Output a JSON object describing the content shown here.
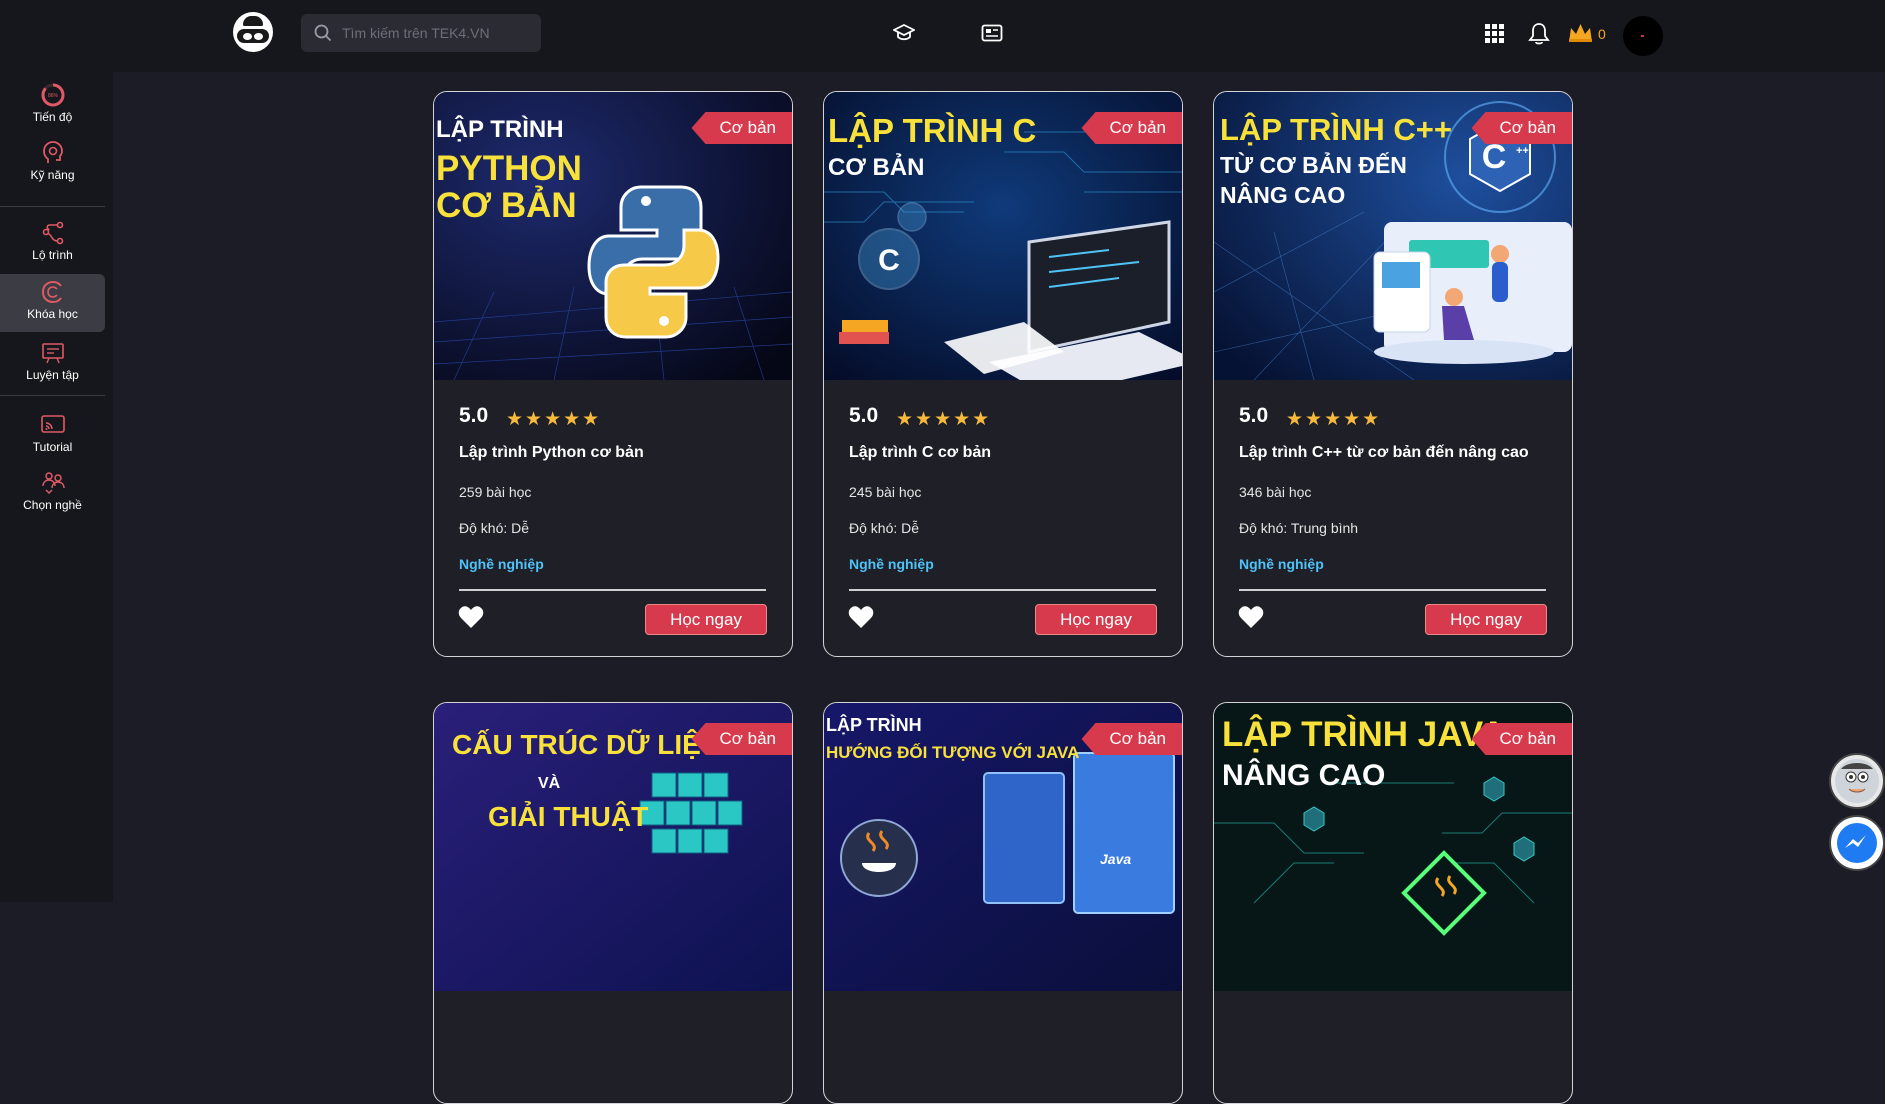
{
  "header": {
    "search_placeholder": "Tìm kiếm trên TEK4.VN",
    "crown_count": "0"
  },
  "sidebar": {
    "items": [
      {
        "label": "Tiến độ",
        "badge": "86%"
      },
      {
        "label": "Kỹ năng"
      },
      {
        "label": "Lộ trình"
      },
      {
        "label": "Khóa học"
      },
      {
        "label": "Luyện tập"
      },
      {
        "label": "Tutorial"
      },
      {
        "label": "Chọn nghề"
      }
    ]
  },
  "courses": [
    {
      "badge": "Cơ bản",
      "thumb_lines": [
        "LẬP TRÌNH",
        "PYTHON",
        "CƠ BẢN"
      ],
      "rating": "5.0",
      "stars": "★★★★★",
      "title": "Lập trình Python cơ bản",
      "lessons": "259 bài học",
      "difficulty": "Độ khó: Dễ",
      "career": "Nghề nghiệp",
      "button": "Học ngay"
    },
    {
      "badge": "Cơ bản",
      "thumb_lines": [
        "LẬP TRÌNH C",
        "CƠ BẢN"
      ],
      "rating": "5.0",
      "stars": "★★★★★",
      "title": "Lập trình C cơ bản",
      "lessons": "245 bài học",
      "difficulty": "Độ khó: Dễ",
      "career": "Nghề nghiệp",
      "button": "Học ngay"
    },
    {
      "badge": "Cơ bản",
      "thumb_lines": [
        "LẬP TRÌNH C++",
        "TỪ CƠ BẢN ĐẾN",
        "NÂNG CAO"
      ],
      "rating": "5.0",
      "stars": "★★★★★",
      "title": "Lập trình C++ từ cơ bản đến nâng cao",
      "lessons": "346 bài học",
      "difficulty": "Độ khó: Trung bình",
      "career": "Nghề nghiệp",
      "button": "Học ngay"
    },
    {
      "badge": "Cơ bản",
      "thumb_lines": [
        "CẤU TRÚC DỮ LIỆU",
        "VÀ",
        "GIẢI THUẬT"
      ]
    },
    {
      "badge": "Cơ bản",
      "thumb_lines": [
        "LẬP TRÌNH",
        "HƯỚNG ĐỐI TƯỢNG VỚI JAVA",
        "Java"
      ]
    },
    {
      "badge": "Cơ bản",
      "thumb_lines": [
        "LẬP TRÌNH JAVA",
        "NÂNG CAO"
      ]
    }
  ],
  "colors": {
    "accent_red": "#d73a4d",
    "career_blue": "#4fc3f7",
    "star_gold": "#f6b93b"
  }
}
